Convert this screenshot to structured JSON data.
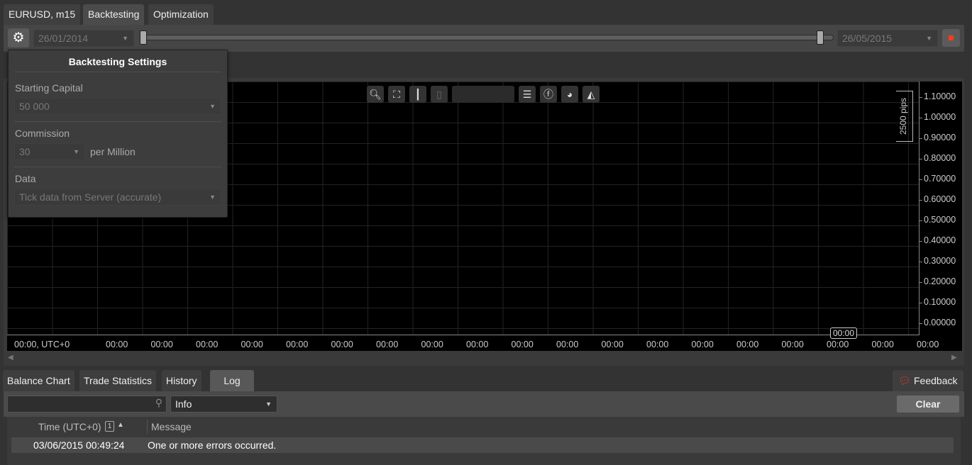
{
  "tabs": [
    {
      "label": "EURUSD, m15"
    },
    {
      "label": "Backtesting"
    },
    {
      "label": "Optimization"
    }
  ],
  "toolbar": {
    "start_date": "26/01/2014",
    "end_date": "26/05/2015",
    "accent_stop": "#ff3b1a"
  },
  "settings": {
    "title": "Backtesting Settings",
    "capital_label": "Starting Capital",
    "capital_value": "50 000",
    "commission_label": "Commission",
    "commission_value": "30",
    "commission_unit": "per Million",
    "data_label": "Data",
    "data_value": "Tick data from Server (accurate)"
  },
  "chart": {
    "pips_label": "2500 pips",
    "y_ticks": [
      "1.10000",
      "1.00000",
      "0.90000",
      "0.80000",
      "0.70000",
      "0.60000",
      "0.50000",
      "0.40000",
      "0.30000",
      "0.20000",
      "0.10000",
      "0.00000"
    ],
    "x_ticks": [
      "00:00, UTC+0",
      "00:00",
      "00:00",
      "00:00",
      "00:00",
      "00:00",
      "00:00",
      "00:00",
      "00:00",
      "00:00",
      "00:00",
      "00:00",
      "00:00",
      "00:00",
      "00:00",
      "00:00",
      "00:00",
      "00:00",
      "00:00",
      "00:00"
    ],
    "cursor_label": "00:00",
    "toolbar_icons": [
      "zoom-icon",
      "chart-settings-icon",
      "candles-icon",
      "timeframe-icon",
      "list-icon",
      "facebook-icon",
      "share-icon",
      "objects-icon"
    ]
  },
  "bottom_tabs": [
    {
      "label": "Balance Chart"
    },
    {
      "label": "Trade Statistics"
    },
    {
      "label": "History"
    },
    {
      "label": "Log"
    }
  ],
  "feedback_label": "Feedback",
  "log": {
    "search_placeholder": "",
    "level_value": "Info",
    "clear_label": "Clear",
    "col_time": "Time (UTC+0)",
    "col_sort_badge": "1",
    "col_message": "Message",
    "rows": [
      {
        "time": "03/06/2015 00:49:24",
        "message": "One or more errors occurred."
      }
    ]
  }
}
